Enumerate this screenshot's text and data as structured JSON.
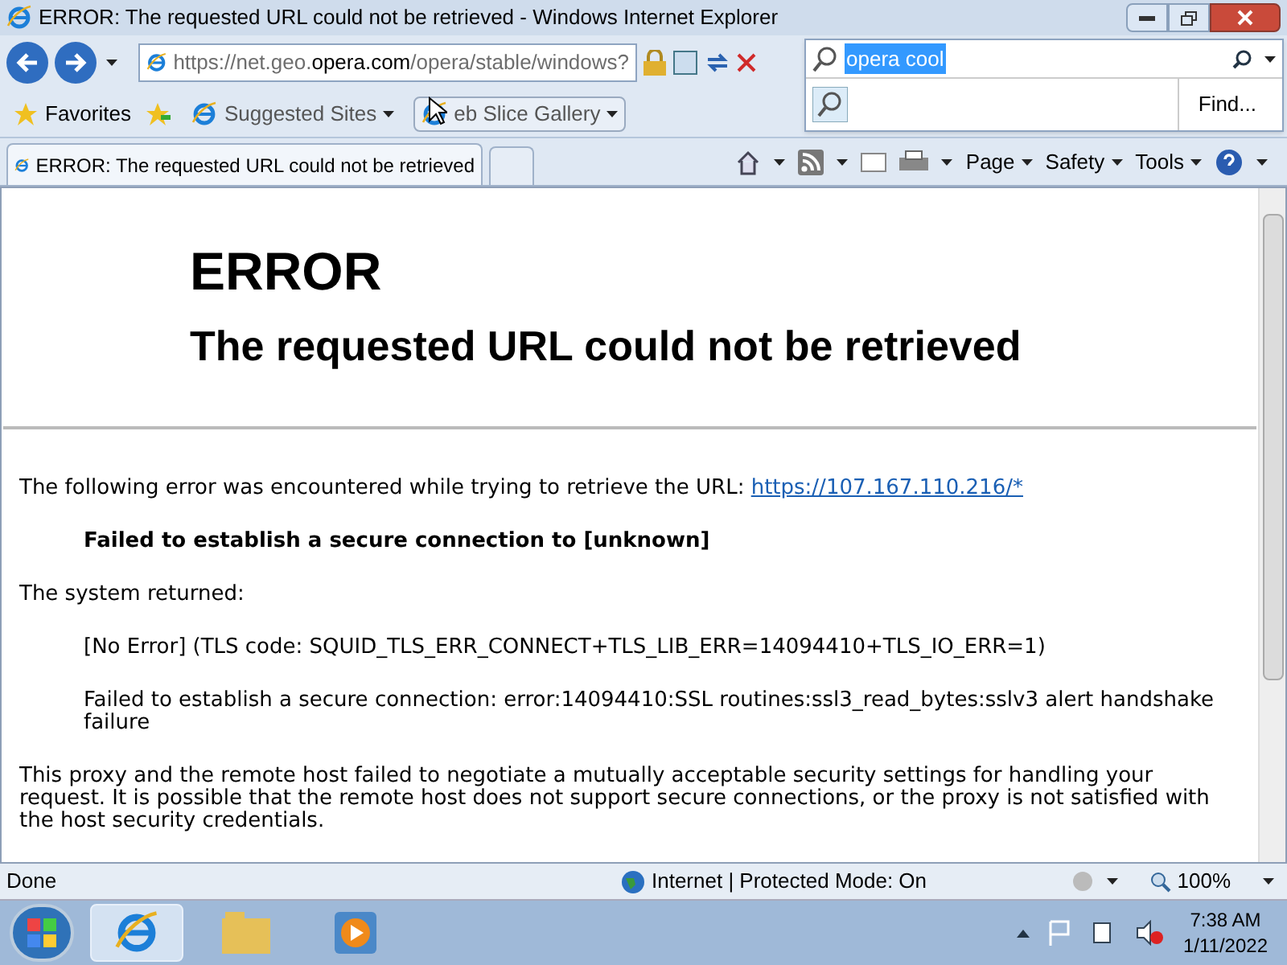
{
  "window": {
    "title": "ERROR: The requested URL could not be retrieved - Windows Internet Explorer"
  },
  "address_bar": {
    "url_parts": [
      {
        "text": "https://",
        "emphasis": false
      },
      {
        "text": "net.geo.",
        "emphasis": false
      },
      {
        "text": "opera.com",
        "emphasis": true
      },
      {
        "text": "/opera/stable/windows?",
        "emphasis": false
      }
    ]
  },
  "search": {
    "value": "opera cool",
    "highlighted": true,
    "find_button": "Find..."
  },
  "favorites_bar": {
    "favorites": "Favorites",
    "items": [
      {
        "label": "Suggested Sites",
        "hovered": false
      },
      {
        "label": "eb Slice Gallery",
        "hovered": true
      }
    ]
  },
  "tabs": [
    {
      "label": "ERROR: The requested URL could not be retrieved",
      "selected": true
    }
  ],
  "command_bar": [
    "Page",
    "Safety",
    "Tools"
  ],
  "page": {
    "heading": "ERROR",
    "subheading": "The requested URL could not be retrieved",
    "blocks": [
      {
        "kind": "text",
        "text": "The following error was encountered while trying to retrieve the URL: ",
        "link": "https://107.167.110.216/*"
      },
      {
        "kind": "bold-indent",
        "text": "Failed to establish a secure connection to [unknown]"
      },
      {
        "kind": "text",
        "text": "The system returned:"
      },
      {
        "kind": "indent",
        "text": "[No Error] (TLS code: SQUID_TLS_ERR_CONNECT+TLS_LIB_ERR=14094410+TLS_IO_ERR=1)"
      },
      {
        "kind": "indent",
        "text": "Failed to establish a secure connection: error:14094410:SSL routines:ssl3_read_bytes:sslv3 alert handshake failure"
      },
      {
        "kind": "text",
        "text": "This proxy and the remote host failed to negotiate a mutually acceptable security settings for handling your request. It is possible that the remote host does not support secure connections, or the proxy is not satisfied with the host security credentials."
      }
    ]
  },
  "status_bar": {
    "status": "Done",
    "zone": "Internet | Protected Mode: On",
    "zoom": "100%"
  },
  "taskbar": {
    "apps": [
      {
        "kind": "ie",
        "selected": true
      },
      {
        "kind": "folder",
        "selected": false
      },
      {
        "kind": "media",
        "selected": false
      }
    ],
    "time": "7:38 AM",
    "date": "1/11/2022"
  }
}
